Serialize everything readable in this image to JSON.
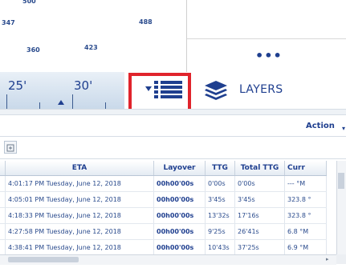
{
  "map": {
    "labels": [
      "500",
      "347",
      "488",
      "360",
      "423"
    ],
    "more_label": "•••"
  },
  "ruler": {
    "label_25": "25'",
    "label_30": "30'"
  },
  "toolbar": {
    "list_icon": "list-icon",
    "layers_icon": "layers-icon",
    "layers_label": "LAYERS"
  },
  "actions": {
    "action_label": "Action",
    "action_caret": "▾"
  },
  "grid": {
    "columns": [
      "",
      "ETA",
      "Layover",
      "TTG",
      "Total TTG",
      "Curr"
    ],
    "rows": [
      [
        "",
        "4:01:17 PM Tuesday, June 12, 2018",
        "00h00'00s",
        "0'00s",
        "0'00s",
        "--- °M"
      ],
      [
        "",
        "4:05:01 PM Tuesday, June 12, 2018",
        "00h00'00s",
        "3'45s",
        "3'45s",
        "323.8 °"
      ],
      [
        "",
        "4:18:33 PM Tuesday, June 12, 2018",
        "00h00'00s",
        "13'32s",
        "17'16s",
        "323.8 °"
      ],
      [
        "",
        "4:27:58 PM Tuesday, June 12, 2018",
        "00h00'00s",
        "9'25s",
        "26'41s",
        "6.8 °M"
      ],
      [
        "",
        "4:38:41 PM Tuesday, June 12, 2018",
        "00h00'00s",
        "10'43s",
        "37'25s",
        "6.9 °M"
      ]
    ]
  },
  "colors": {
    "accent": "#1f3f8f",
    "highlight_border": "#e0242c"
  }
}
